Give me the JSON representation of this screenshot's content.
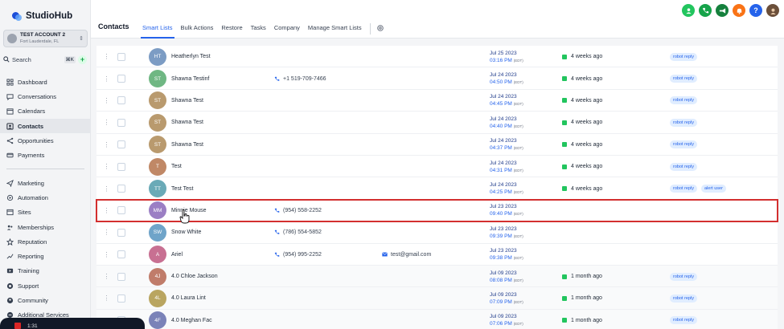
{
  "app": {
    "logo": "StudioHub"
  },
  "account": {
    "name": "TEST ACCOUNT 2",
    "location": "Fort Lauderdale, FL"
  },
  "search": {
    "label": "Search",
    "shortcut": "⌘K",
    "add": "+"
  },
  "sidebar": {
    "items": [
      {
        "label": "Dashboard",
        "icon": "grid-icon"
      },
      {
        "label": "Conversations",
        "icon": "chat-icon"
      },
      {
        "label": "Calendars",
        "icon": "calendar-icon"
      },
      {
        "label": "Contacts",
        "icon": "contacts-icon",
        "active": true
      },
      {
        "label": "Opportunities",
        "icon": "opportunities-icon"
      },
      {
        "label": "Payments",
        "icon": "payments-icon"
      }
    ],
    "items2": [
      {
        "label": "Marketing",
        "icon": "send-icon"
      },
      {
        "label": "Automation",
        "icon": "automation-icon"
      },
      {
        "label": "Sites",
        "icon": "sites-icon"
      },
      {
        "label": "Memberships",
        "icon": "memberships-icon"
      },
      {
        "label": "Reputation",
        "icon": "star-icon"
      },
      {
        "label": "Reporting",
        "icon": "trend-icon"
      },
      {
        "label": "Training",
        "icon": "training-icon"
      },
      {
        "label": "Support",
        "icon": "support-icon"
      },
      {
        "label": "Community",
        "icon": "community-icon"
      },
      {
        "label": "Additional Services",
        "icon": "services-icon"
      }
    ]
  },
  "header": {
    "title": "Contacts",
    "tabs": [
      "Smart Lists",
      "Bulk Actions",
      "Restore",
      "Tasks",
      "Company",
      "Manage Smart Lists"
    ],
    "active_tab": "Smart Lists"
  },
  "top_icons": [
    {
      "name": "contact-icon",
      "color": "#22c55e"
    },
    {
      "name": "phone-icon",
      "color": "#16a34a"
    },
    {
      "name": "megaphone-icon",
      "color": "#15803d"
    },
    {
      "name": "bell-icon",
      "color": "#f97316"
    },
    {
      "name": "help-icon",
      "color": "#2563eb"
    }
  ],
  "contacts": [
    {
      "initials": "HT",
      "name": "Heatherlyn Test",
      "color": "#7c9cc4",
      "phone": "",
      "email": "",
      "date": "Jul 25 2023",
      "time": "03:16 PM",
      "tz": "(EDT)",
      "activity": "4 weeks ago",
      "tags": [
        "robot reply"
      ]
    },
    {
      "initials": "ST",
      "name": "Shawna Testinf",
      "color": "#6fb783",
      "phone": "+1 519-709-7466",
      "email": "",
      "date": "Jul 24 2023",
      "time": "04:50 PM",
      "tz": "(EDT)",
      "activity": "4 weeks ago",
      "tags": [
        "robot reply"
      ]
    },
    {
      "initials": "ST",
      "name": "Shawna Test",
      "color": "#b99a6e",
      "phone": "",
      "email": "",
      "date": "Jul 24 2023",
      "time": "04:45 PM",
      "tz": "(EDT)",
      "activity": "4 weeks ago",
      "tags": [
        "robot reply"
      ]
    },
    {
      "initials": "ST",
      "name": "Shawna Test",
      "color": "#b99a6e",
      "phone": "",
      "email": "",
      "date": "Jul 24 2023",
      "time": "04:40 PM",
      "tz": "(EDT)",
      "activity": "4 weeks ago",
      "tags": [
        "robot reply"
      ]
    },
    {
      "initials": "ST",
      "name": "Shawna Test",
      "color": "#b99a6e",
      "phone": "",
      "email": "",
      "date": "Jul 24 2023",
      "time": "04:37 PM",
      "tz": "(EDT)",
      "activity": "4 weeks ago",
      "tags": [
        "robot reply"
      ]
    },
    {
      "initials": "T",
      "name": "Test",
      "color": "#c08866",
      "phone": "",
      "email": "",
      "date": "Jul 24 2023",
      "time": "04:31 PM",
      "tz": "(EDT)",
      "activity": "4 weeks ago",
      "tags": [
        "robot reply"
      ]
    },
    {
      "initials": "TT",
      "name": "Test Test",
      "color": "#6aaab7",
      "phone": "",
      "email": "",
      "date": "Jul 24 2023",
      "time": "04:25 PM",
      "tz": "(EDT)",
      "activity": "4 weeks ago",
      "tags": [
        "robot reply",
        "alert user"
      ]
    },
    {
      "initials": "MM",
      "name": "Minnie Mouse",
      "color": "#9b7fc4",
      "phone": "(954) 558-2252",
      "email": "",
      "date": "Jul 23 2023",
      "time": "09:40 PM",
      "tz": "(EDT)",
      "activity": "",
      "tags": [],
      "highlight": true
    },
    {
      "initials": "SW",
      "name": "Snow White",
      "color": "#6fa4c9",
      "phone": "(786) 554-5852",
      "email": "",
      "date": "Jul 23 2023",
      "time": "09:39 PM",
      "tz": "(EDT)",
      "activity": "",
      "tags": []
    },
    {
      "initials": "A",
      "name": "Ariel",
      "color": "#c87092",
      "phone": "(954) 995-2252",
      "email": "test@gmail.com",
      "date": "Jul 23 2023",
      "time": "09:38 PM",
      "tz": "(EDT)",
      "activity": "",
      "tags": []
    },
    {
      "initials": "4J",
      "name": "4.0 Chloe Jackson",
      "color": "#c07c6a",
      "phone": "",
      "email": "",
      "date": "Jul 09 2023",
      "time": "08:08 PM",
      "tz": "(EDT)",
      "activity": "1 month ago",
      "tags": [
        "robot reply"
      ]
    },
    {
      "initials": "4L",
      "name": "4.0 Laura Lint",
      "color": "#b9a560",
      "phone": "",
      "email": "",
      "date": "Jul 09 2023",
      "time": "07:09 PM",
      "tz": "(EDT)",
      "activity": "1 month ago",
      "tags": [
        "robot reply"
      ]
    },
    {
      "initials": "4F",
      "name": "4.0 Meghan Fac",
      "color": "#7a82b8",
      "phone": "",
      "email": "",
      "date": "Jul 09 2023",
      "time": "07:06 PM",
      "tz": "(EDT)",
      "activity": "1 month ago",
      "tags": [
        "robot reply"
      ]
    }
  ],
  "recorder": {
    "time": "1:31"
  }
}
